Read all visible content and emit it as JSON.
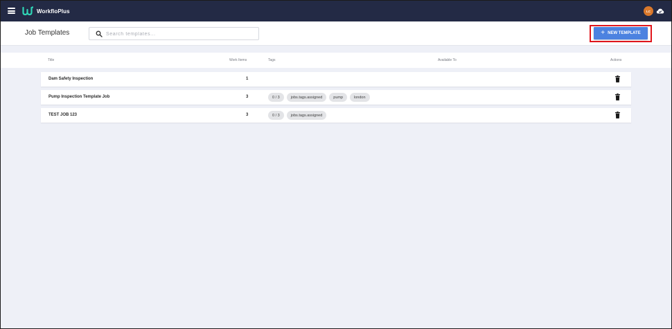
{
  "app": {
    "brand": "WorkfloPlus",
    "user_initials": "LC"
  },
  "header": {
    "page_title": "Job Templates",
    "search_placeholder": "Search templates...",
    "new_button_label": "NEW TEMPLATE"
  },
  "table": {
    "columns": {
      "title": "Title",
      "work_items": "Work Items",
      "tags": "Tags",
      "available_to": "Available To",
      "actions": "Actions"
    },
    "rows": [
      {
        "title": "Dam Safety Inspection",
        "work_items": "1",
        "tags": []
      },
      {
        "title": "Pump Inspection Template Job",
        "work_items": "3",
        "tags": [
          "0 / 3",
          "jobs.tags.assigned",
          "pump",
          "london"
        ]
      },
      {
        "title": "TEST JOB 123",
        "work_items": "3",
        "tags": [
          "0 / 3",
          "jobs.tags.assigned"
        ]
      }
    ]
  },
  "colors": {
    "topbar": "#232a45",
    "accent": "#4c82e0",
    "highlight": "#e0151b",
    "logo": "#2fd5b6",
    "avatar": "#d9782b"
  },
  "icons": {
    "menu": "hamburger-icon",
    "search": "search-icon",
    "sync": "cloud-icon",
    "delete": "trash-icon"
  }
}
